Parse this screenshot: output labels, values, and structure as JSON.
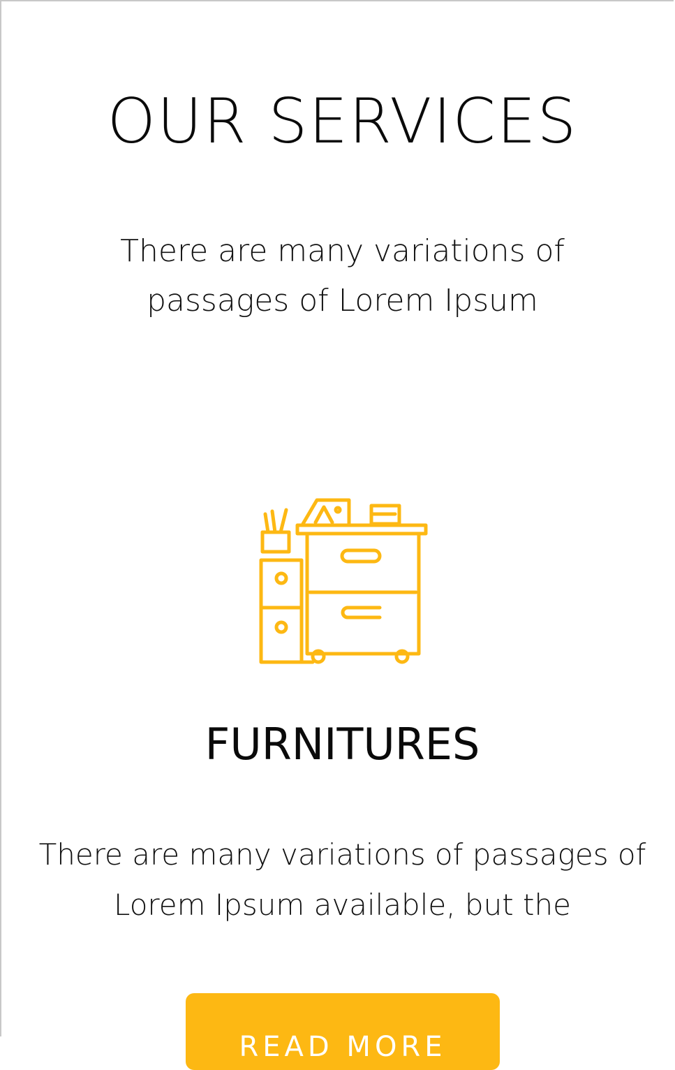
{
  "section": {
    "title": "OUR SERVICES",
    "subtitle": "There are many variations of passages of Lorem Ipsum"
  },
  "service": {
    "icon": "furniture-cabinet-icon",
    "title": "FURNITURES",
    "description": "There are many variations of passages of Lorem Ipsum available, but the",
    "button_label": "READ MORE"
  },
  "colors": {
    "accent": "#fdb813",
    "text": "#111111",
    "background": "#ffffff"
  }
}
